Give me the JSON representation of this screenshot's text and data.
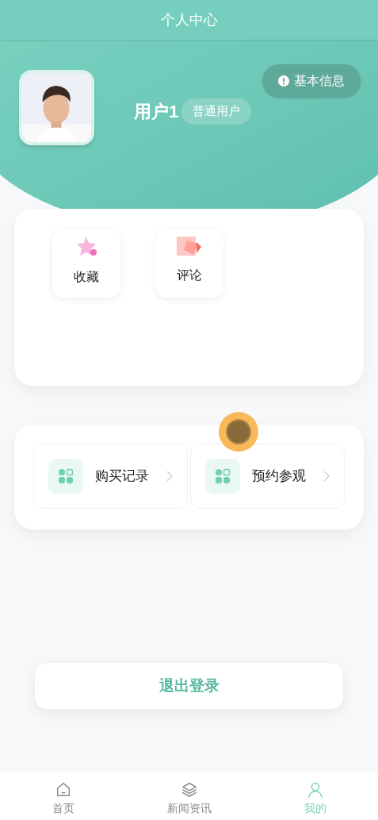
{
  "header": {
    "title": "个人中心"
  },
  "profile": {
    "name": "用户1",
    "role": "普通用户",
    "info_button": "基本信息"
  },
  "shortcuts": [
    {
      "kind": "star",
      "label": "收藏"
    },
    {
      "kind": "note",
      "label": "评论"
    }
  ],
  "menu": [
    {
      "label": "购买记录"
    },
    {
      "label": "预约参观"
    }
  ],
  "logout": "退出登录",
  "tabs": [
    {
      "kind": "home",
      "label": "首页",
      "selected": false
    },
    {
      "kind": "layers",
      "label": "新闻资讯",
      "selected": false
    },
    {
      "kind": "user",
      "label": "我的",
      "selected": true
    }
  ]
}
